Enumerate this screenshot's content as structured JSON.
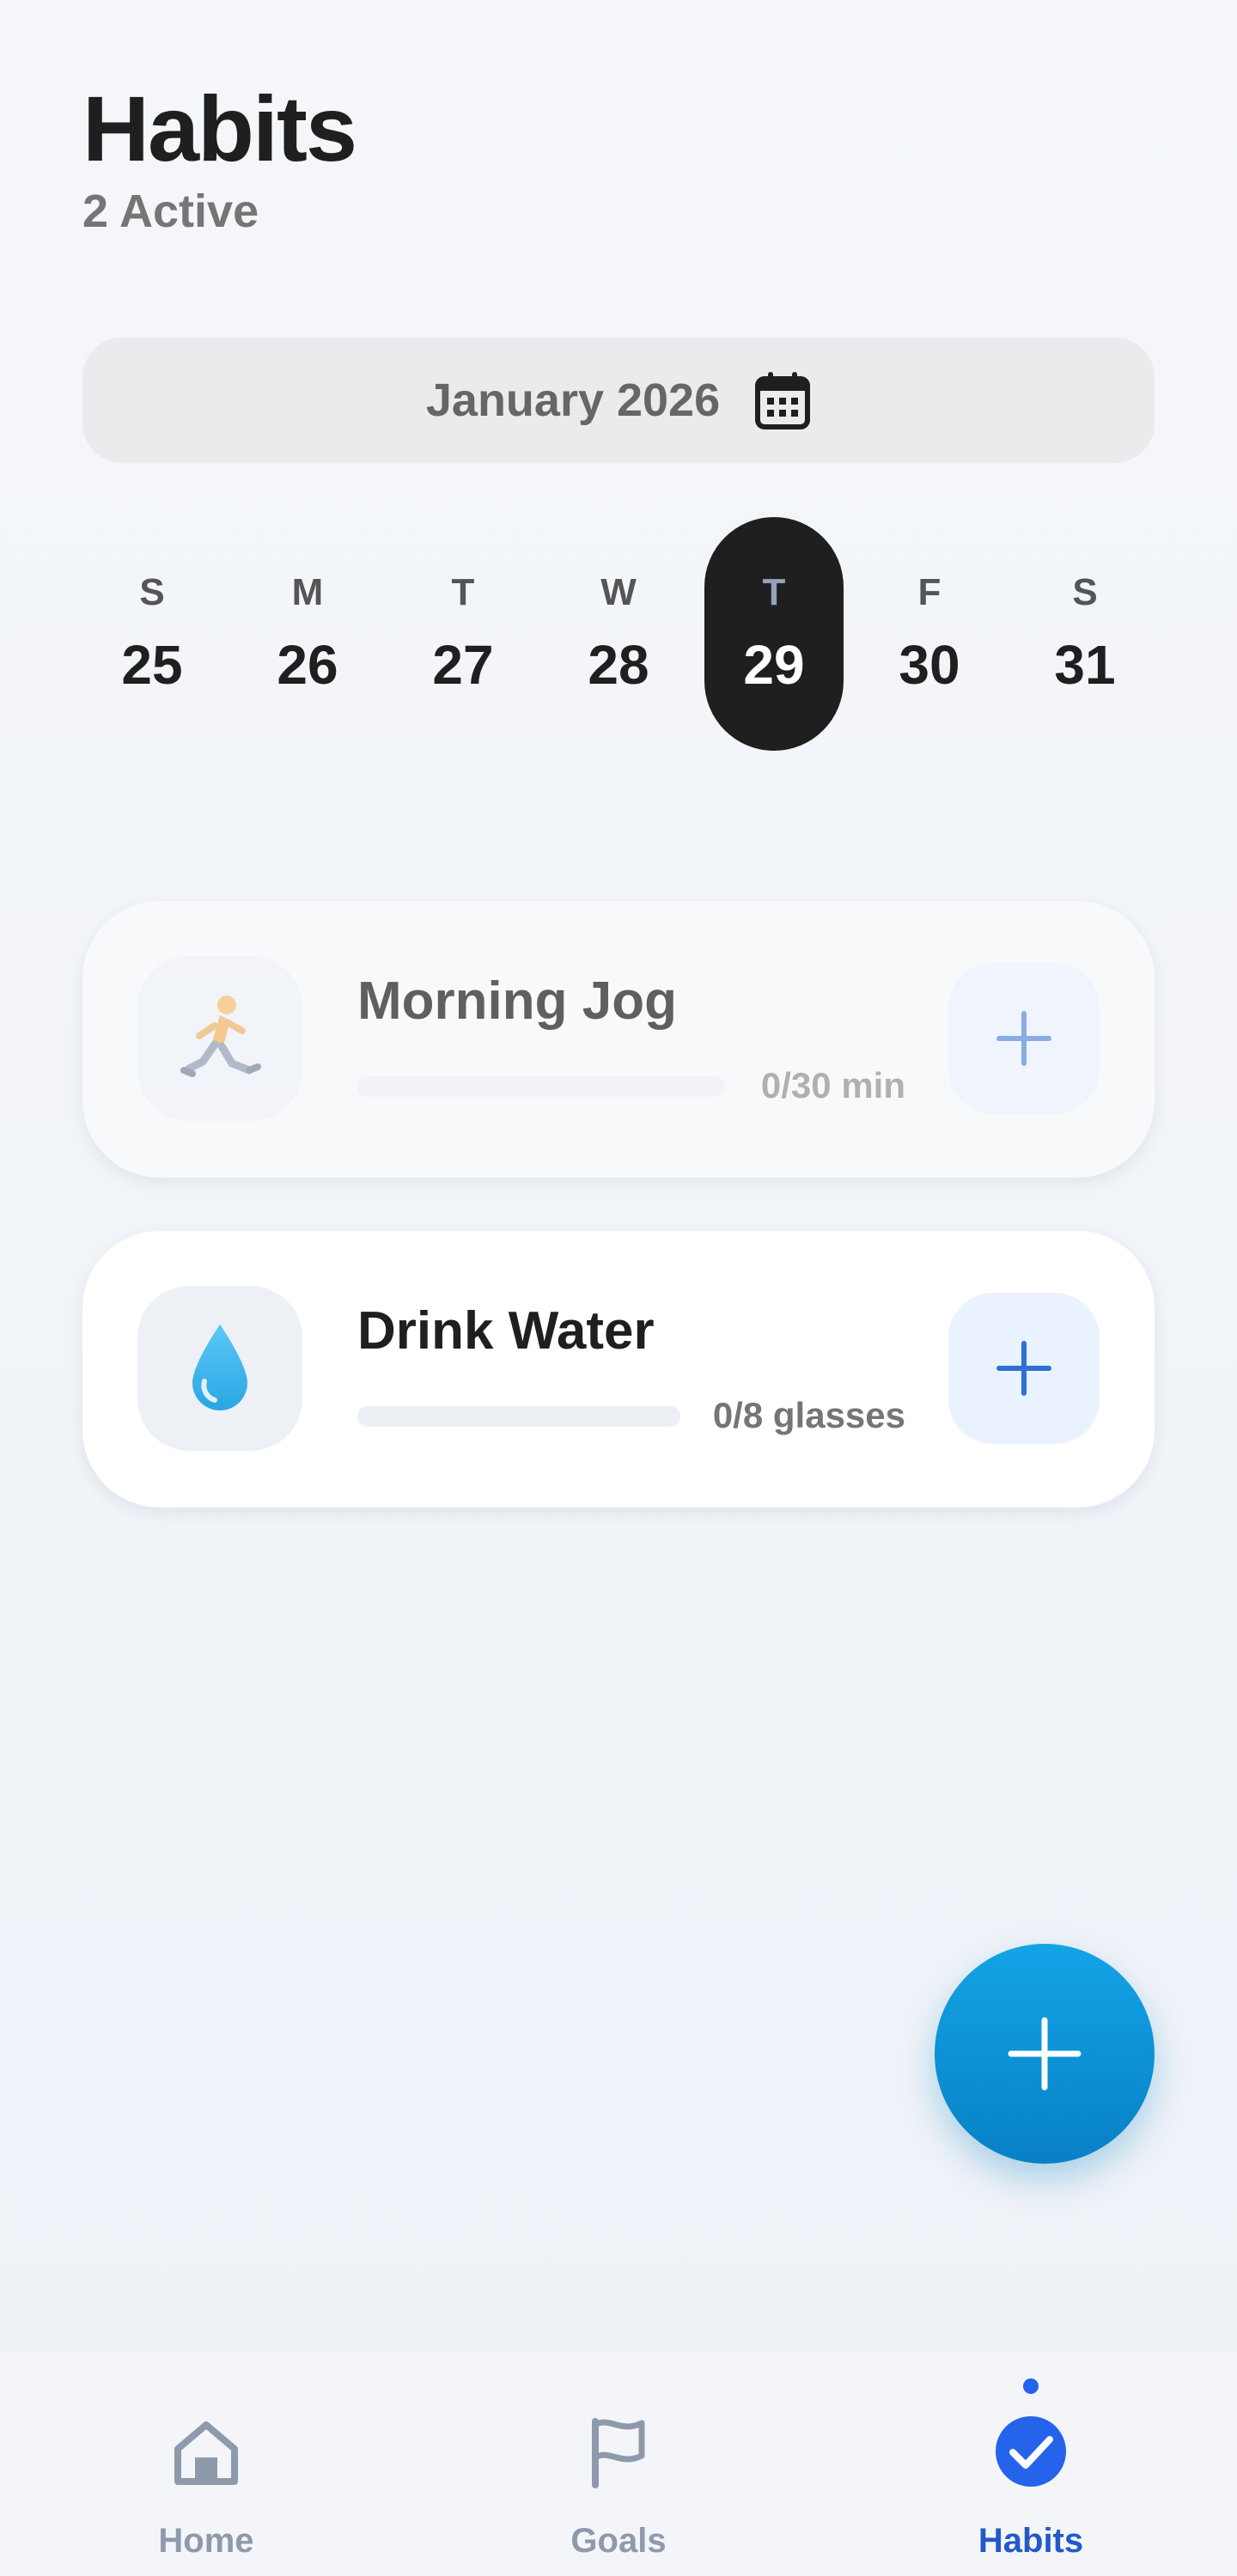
{
  "header": {
    "title": "Habits",
    "subtitle": "2 Active"
  },
  "month_selector": {
    "label": "January 2026",
    "icon": "calendar-icon"
  },
  "week": [
    {
      "dow": "S",
      "day": "25",
      "selected": false
    },
    {
      "dow": "M",
      "day": "26",
      "selected": false
    },
    {
      "dow": "T",
      "day": "27",
      "selected": false
    },
    {
      "dow": "W",
      "day": "28",
      "selected": false
    },
    {
      "dow": "T",
      "day": "29",
      "selected": true
    },
    {
      "dow": "F",
      "day": "30",
      "selected": false
    },
    {
      "dow": "S",
      "day": "31",
      "selected": false
    }
  ],
  "habits": [
    {
      "name": "Morning Jog",
      "icon": "runner-icon",
      "progress_text": "0/30 min",
      "progress": 0,
      "dimmed": true
    },
    {
      "name": "Drink Water",
      "icon": "water-drop-icon",
      "progress_text": "0/8 glasses",
      "progress": 0,
      "dimmed": false
    }
  ],
  "fab": {
    "icon": "plus-icon"
  },
  "bottom_nav": {
    "items": [
      {
        "label": "Home",
        "icon": "home-icon",
        "active": false
      },
      {
        "label": "Goals",
        "icon": "flag-icon",
        "active": false
      },
      {
        "label": "Habits",
        "icon": "check-circle-icon",
        "active": true
      }
    ]
  },
  "colors": {
    "accent": "#2563eb",
    "fab": "#0a8fd6",
    "selected_day": "#1f1f1f",
    "background": "#f3f5f8"
  }
}
